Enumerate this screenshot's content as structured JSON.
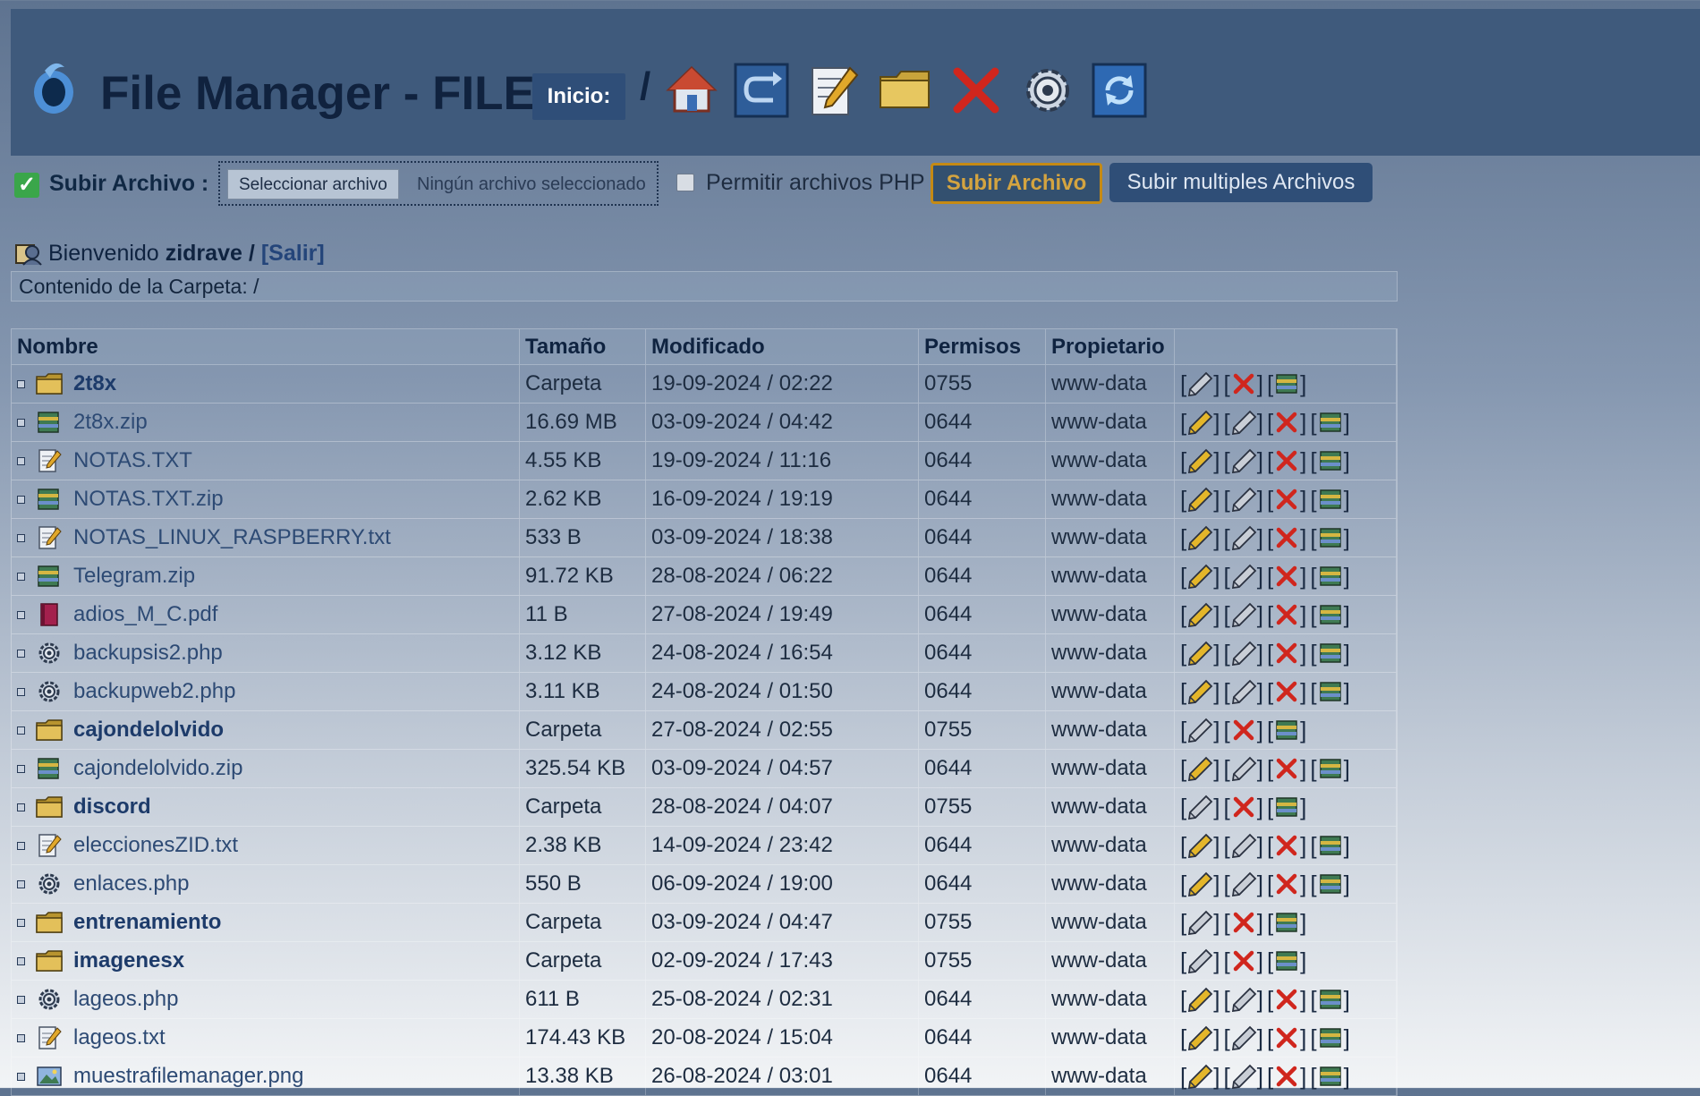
{
  "header": {
    "title": "File Manager - FILE4",
    "inicio_label": "Inicio:",
    "path_separator": "/",
    "toolbar_icons": [
      "home-icon",
      "back-icon",
      "edit-icon",
      "folder-icon",
      "delete-icon",
      "settings-icon",
      "refresh-icon"
    ]
  },
  "upload": {
    "label": "Subir Archivo :",
    "choose_button": "Seleccionar archivo",
    "no_file_text": "Ningún archivo seleccionado",
    "allow_php_label": "Permitir archivos PHP",
    "upload_button": "Subir Archivo",
    "multi_button": "Subir multiples Archivos"
  },
  "welcome": {
    "prefix": "Bienvenido",
    "user": "zidrave",
    "separator": "/",
    "logout": "[Salir]"
  },
  "folder_content": "Contenido de la Carpeta: /",
  "table": {
    "columns": [
      "Nombre",
      "Tamaño",
      "Modificado",
      "Permisos",
      "Propietario"
    ],
    "rows": [
      {
        "name": "2t8x",
        "type": "folder",
        "size": "Carpeta",
        "modified": "19-09-2024 / 02:22",
        "perms": "0755",
        "owner": "www-data"
      },
      {
        "name": "2t8x.zip",
        "type": "zip",
        "size": "16.69 MB",
        "modified": "03-09-2024 / 04:42",
        "perms": "0644",
        "owner": "www-data"
      },
      {
        "name": "NOTAS.TXT",
        "type": "txt",
        "size": "4.55 KB",
        "modified": "19-09-2024 / 11:16",
        "perms": "0644",
        "owner": "www-data"
      },
      {
        "name": "NOTAS.TXT.zip",
        "type": "zip",
        "size": "2.62 KB",
        "modified": "16-09-2024 / 19:19",
        "perms": "0644",
        "owner": "www-data"
      },
      {
        "name": "NOTAS_LINUX_RASPBERRY.txt",
        "type": "txt",
        "size": "533 B",
        "modified": "03-09-2024 / 18:38",
        "perms": "0644",
        "owner": "www-data"
      },
      {
        "name": "Telegram.zip",
        "type": "zip",
        "size": "91.72 KB",
        "modified": "28-08-2024 / 06:22",
        "perms": "0644",
        "owner": "www-data"
      },
      {
        "name": "adios_M_C.pdf",
        "type": "pdf",
        "size": "11 B",
        "modified": "27-08-2024 / 19:49",
        "perms": "0644",
        "owner": "www-data"
      },
      {
        "name": "backupsis2.php",
        "type": "php",
        "size": "3.12 KB",
        "modified": "24-08-2024 / 16:54",
        "perms": "0644",
        "owner": "www-data"
      },
      {
        "name": "backupweb2.php",
        "type": "php",
        "size": "3.11 KB",
        "modified": "24-08-2024 / 01:50",
        "perms": "0644",
        "owner": "www-data"
      },
      {
        "name": "cajondelolvido",
        "type": "folder",
        "size": "Carpeta",
        "modified": "27-08-2024 / 02:55",
        "perms": "0755",
        "owner": "www-data"
      },
      {
        "name": "cajondelolvido.zip",
        "type": "zip",
        "size": "325.54 KB",
        "modified": "03-09-2024 / 04:57",
        "perms": "0644",
        "owner": "www-data"
      },
      {
        "name": "discord",
        "type": "folder",
        "size": "Carpeta",
        "modified": "28-08-2024 / 04:07",
        "perms": "0755",
        "owner": "www-data"
      },
      {
        "name": "eleccionesZID.txt",
        "type": "txt",
        "size": "2.38 KB",
        "modified": "14-09-2024 / 23:42",
        "perms": "0644",
        "owner": "www-data"
      },
      {
        "name": "enlaces.php",
        "type": "php",
        "size": "550 B",
        "modified": "06-09-2024 / 19:00",
        "perms": "0644",
        "owner": "www-data"
      },
      {
        "name": "entrenamiento",
        "type": "folder",
        "size": "Carpeta",
        "modified": "03-09-2024 / 04:47",
        "perms": "0755",
        "owner": "www-data"
      },
      {
        "name": "imagenesx",
        "type": "folder",
        "size": "Carpeta",
        "modified": "02-09-2024 / 17:43",
        "perms": "0755",
        "owner": "www-data"
      },
      {
        "name": "lageos.php",
        "type": "php",
        "size": "611 B",
        "modified": "25-08-2024 / 02:31",
        "perms": "0644",
        "owner": "www-data"
      },
      {
        "name": "lageos.txt",
        "type": "txt",
        "size": "174.43 KB",
        "modified": "20-08-2024 / 15:04",
        "perms": "0644",
        "owner": "www-data"
      },
      {
        "name": "muestrafilemanager.png",
        "type": "png",
        "size": "13.38 KB",
        "modified": "26-08-2024 / 03:01",
        "perms": "0644",
        "owner": "www-data"
      }
    ]
  },
  "colors": {
    "header_bg": "#3f5a7c",
    "title": "#10223e",
    "accent_button": "#2f4e77",
    "upload_border": "#c58a14",
    "delete_red": "#d0261d",
    "pencil_yellow": "#e4b62a"
  }
}
